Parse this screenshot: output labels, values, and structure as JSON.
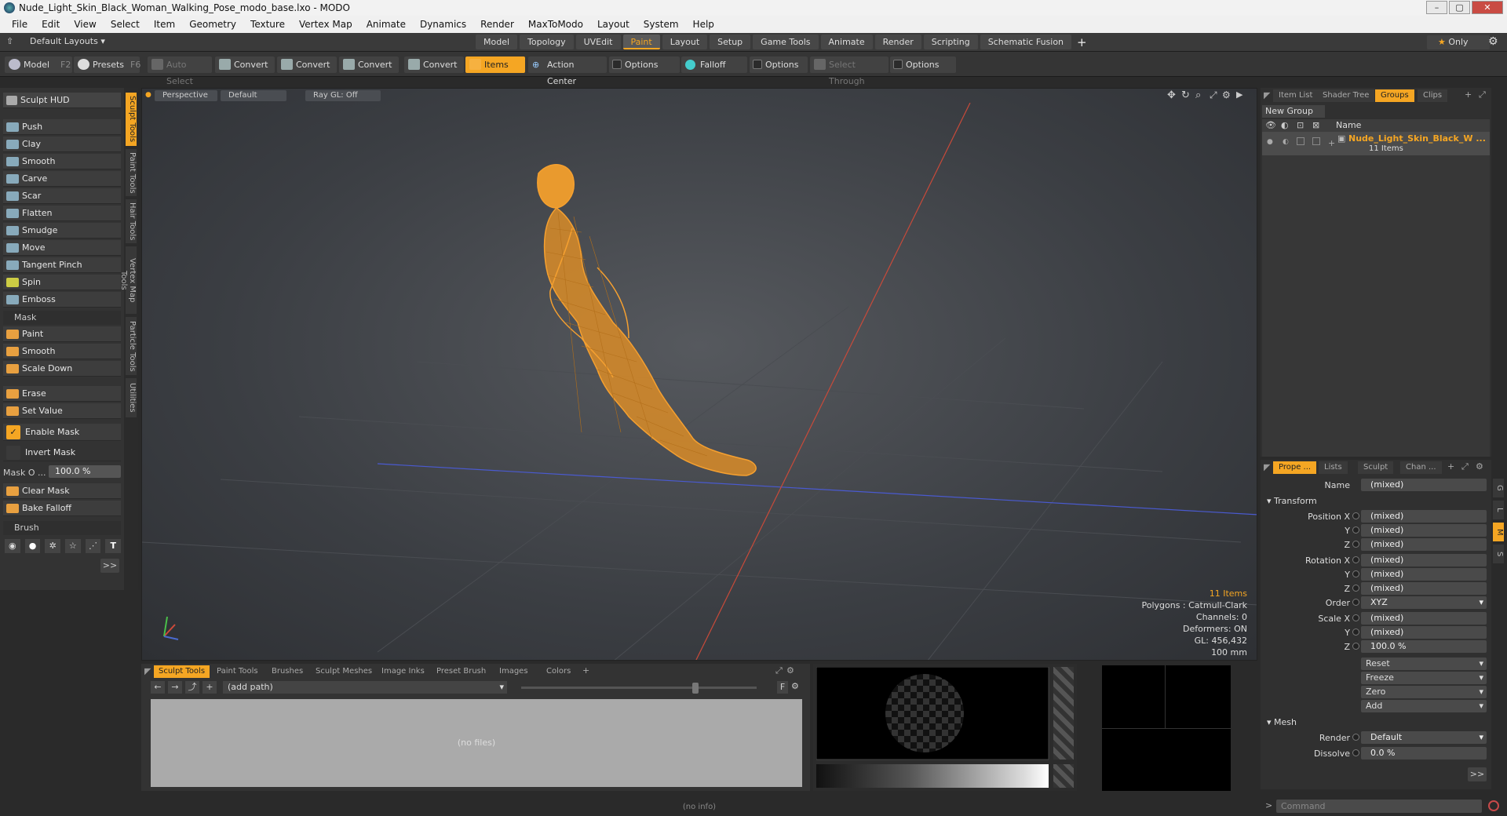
{
  "window": {
    "title": "Nude_Light_Skin_Black_Woman_Walking_Pose_modo_base.lxo - MODO"
  },
  "menu": [
    "File",
    "Edit",
    "View",
    "Select",
    "Item",
    "Geometry",
    "Texture",
    "Vertex Map",
    "Animate",
    "Dynamics",
    "Render",
    "MaxToModo",
    "Layout",
    "System",
    "Help"
  ],
  "layoutbar": {
    "layouts_label": "Default Layouts",
    "tabs": [
      "Model",
      "Topology",
      "UVEdit",
      "Paint",
      "Layout",
      "Setup",
      "Game Tools",
      "Animate",
      "Render",
      "Scripting",
      "Schematic Fusion"
    ],
    "active_tab": "Paint",
    "only_label": "Only"
  },
  "toolbar": {
    "model": "Model",
    "model_key": "F2",
    "presets": "Presets",
    "presets_key": "F6",
    "auto_select": "Auto Select",
    "convert1": "Convert",
    "convert2": "Convert",
    "convert3": "Convert",
    "convert4": "Convert",
    "items": "Items",
    "action_center": "Action Center",
    "options1": "Options",
    "falloff": "Falloff",
    "options2": "Options",
    "select_through": "Select Through",
    "options3": "Options"
  },
  "sculpt": {
    "hud": "Sculpt HUD",
    "tools": [
      "Push",
      "Clay",
      "Smooth",
      "Carve",
      "Scar",
      "Flatten",
      "Smudge",
      "Move",
      "Tangent Pinch",
      "Spin",
      "Emboss"
    ],
    "mask_header": "Mask",
    "mask_tools": [
      "Paint",
      "Smooth",
      "Scale Down"
    ],
    "erase": "Erase",
    "set_value": "Set Value",
    "enable_mask": "Enable Mask",
    "invert_mask": "Invert Mask",
    "mask_opacity_label": "Mask O ...",
    "mask_opacity_value": "100.0 %",
    "clear_mask": "Clear Mask",
    "bake_falloff": "Bake Falloff",
    "brush_header": "Brush",
    "more": ">>"
  },
  "sidetabs": [
    "Sculpt Tools",
    "Paint Tools",
    "Hair Tools",
    "Vertex Map Tools",
    "Particle Tools",
    "Utilities"
  ],
  "viewport": {
    "view": "Perspective",
    "shading": "Default",
    "raygl": "Ray GL: Off",
    "info": {
      "items": "11 Items",
      "polygons": "Polygons : Catmull-Clark",
      "channels": "Channels: 0",
      "deformers": "Deformers: ON",
      "gl": "GL: 456,432",
      "grid": "100 mm"
    }
  },
  "groups_panel": {
    "tabs": [
      "Item List",
      "Shader Tree",
      "Groups",
      "Clips"
    ],
    "active": "Groups",
    "new_group": "New Group",
    "col_name": "Name",
    "group_name": "Nude_Light_Skin_Black_W ...",
    "group_count": "11 Items"
  },
  "properties": {
    "tabs": [
      "Prope ...",
      "Lists",
      "Sculpt",
      "Chan ..."
    ],
    "name_label": "Name",
    "name_value": "(mixed)",
    "transform": "Transform",
    "position_label": "Position X",
    "rotation_label": "Rotation X",
    "scale_label": "Scale X",
    "y": "Y",
    "z": "Z",
    "mixed": "(mixed)",
    "scale_z": "100.0 %",
    "order_label": "Order",
    "order_value": "XYZ",
    "reset": "Reset",
    "freeze": "Freeze",
    "zero": "Zero",
    "add": "Add",
    "mesh": "Mesh",
    "render_label": "Render",
    "render_value": "Default",
    "dissolve_label": "Dissolve",
    "dissolve_value": "0.0 %",
    "more": ">>"
  },
  "bottom": {
    "tabs": [
      "Sculpt Tools",
      "Paint Tools",
      "Brushes",
      "Sculpt Meshes",
      "Image Inks",
      "Preset Brush",
      "Images",
      "Colors"
    ],
    "active": "Sculpt Tools",
    "path": "(add path)",
    "files": "(no files)",
    "f_button": "F"
  },
  "status": {
    "info": "(no info)"
  },
  "command": {
    "placeholder": "Command"
  },
  "colors": {
    "accent": "#f5a623",
    "mesh": "#f5a030"
  }
}
